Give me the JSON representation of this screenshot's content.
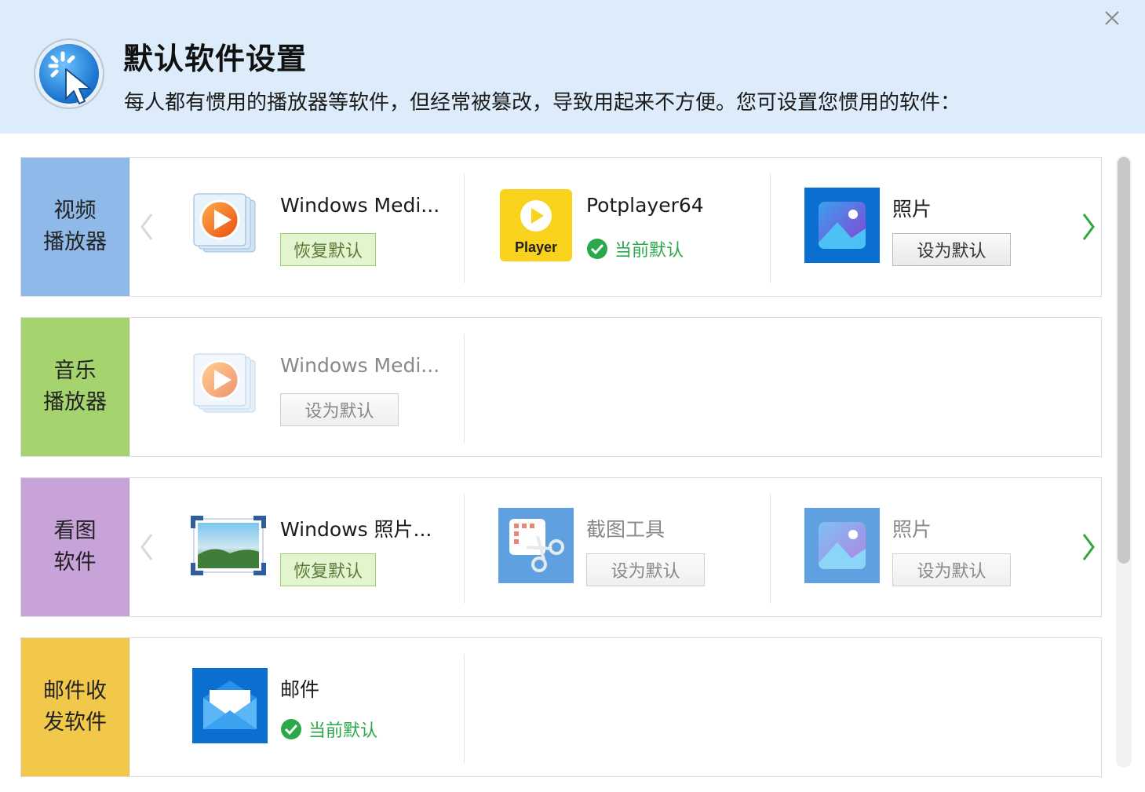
{
  "header": {
    "title": "默认软件设置",
    "subtitle": "每人都有惯用的播放器等软件，但经常被篡改，导致用起来不方便。您可设置您惯用的软件："
  },
  "labels": {
    "restore": "恢复默认",
    "set_default": "设为默认",
    "current_default": "当前默认"
  },
  "colors": {
    "header_bg": "#dcecfa",
    "video": "#8fb9e8",
    "music": "#a5d36e",
    "image": "#c8a3d9",
    "mail": "#f2c84b",
    "status_green": "#2aa84a"
  },
  "categories": [
    {
      "line1": "视频",
      "line2": "播放器",
      "apps": [
        {
          "name": "Windows Medi...",
          "icon": "windows-media-player-icon",
          "state": "restore"
        },
        {
          "name": "Potplayer64",
          "icon": "potplayer-icon",
          "icon_text": "Player",
          "state": "current"
        },
        {
          "name": "照片",
          "icon": "photos-icon",
          "state": "set"
        }
      ]
    },
    {
      "line1": "音乐",
      "line2": "播放器",
      "apps": [
        {
          "name": "Windows Medi...",
          "icon": "windows-media-player-icon",
          "state": "set-dim"
        }
      ]
    },
    {
      "line1": "看图",
      "line2": "软件",
      "apps": [
        {
          "name": "Windows 照片...",
          "icon": "windows-photo-viewer-icon",
          "state": "restore"
        },
        {
          "name": "截图工具",
          "icon": "snipping-tool-icon",
          "state": "set-dim"
        },
        {
          "name": "照片",
          "icon": "photos-icon",
          "state": "set-dim"
        }
      ]
    },
    {
      "line1": "邮件收",
      "line2": "发软件",
      "apps": [
        {
          "name": "邮件",
          "icon": "mail-icon",
          "state": "current"
        }
      ]
    }
  ]
}
